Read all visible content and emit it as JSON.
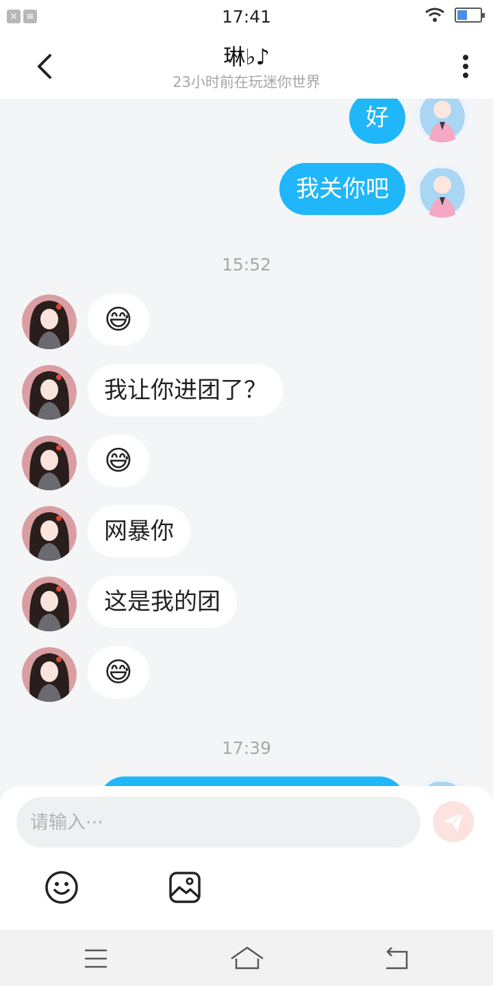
{
  "status_bar": {
    "time": "17:41"
  },
  "header": {
    "title": "琳♭♪",
    "subtitle": "23小时前在玩迷你世界",
    "back_icon": "chevron-left-icon",
    "more_icon": "more-vertical-icon"
  },
  "messages": [
    {
      "side": "out",
      "text": "好"
    },
    {
      "side": "out",
      "text": "我关你吧"
    },
    {
      "type": "time",
      "text": "15:52"
    },
    {
      "side": "in",
      "text": "😅"
    },
    {
      "side": "in",
      "text": "我让你进团了？"
    },
    {
      "side": "in",
      "text": "😅"
    },
    {
      "side": "in",
      "text": "网暴你"
    },
    {
      "side": "in",
      "text": "这是我的团"
    },
    {
      "side": "in",
      "text": "😅"
    },
    {
      "type": "time",
      "text": "17:39"
    }
  ],
  "composer": {
    "placeholder": "请输入···",
    "send_icon": "paper-plane-icon",
    "emoji_icon": "smiley-icon",
    "image_icon": "image-icon"
  },
  "nav_bar": {
    "menu_icon": "menu-icon",
    "home_icon": "home-icon",
    "back_icon": "back-icon"
  },
  "colors": {
    "accent": "#1fb6fa",
    "background": "#f4f5f7",
    "incoming_bubble": "#ffffff",
    "send_button": "#fde3e0"
  }
}
